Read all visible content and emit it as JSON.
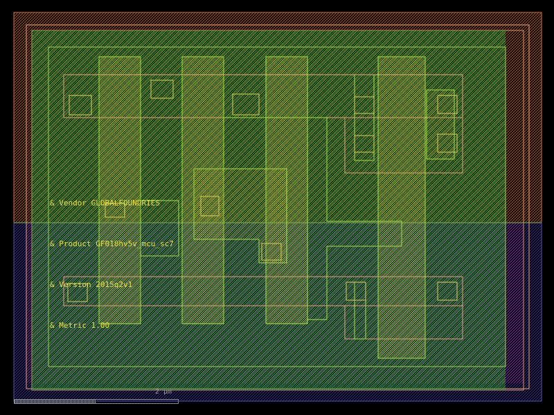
{
  "layout_view": {
    "texts": {
      "vendor": "& Vendor GLOBALFOUNDRIES",
      "product": "& Product GF018hv5v_mcu_sc7",
      "version": "& Version 2015q2v1",
      "metric": "& Metric 1.00"
    },
    "scale_bar": {
      "label": "2 µm"
    },
    "layer_colors": {
      "nwell": "#d07040",
      "pwell": "#4a3aa0",
      "implant": "#c040c0",
      "diffusion": "#40c040",
      "poly": "#e0d050",
      "metal1": "#9ad040",
      "contact": "#e0d050",
      "cell_outline": "#e8a078",
      "label_text": "#e8e040"
    }
  }
}
